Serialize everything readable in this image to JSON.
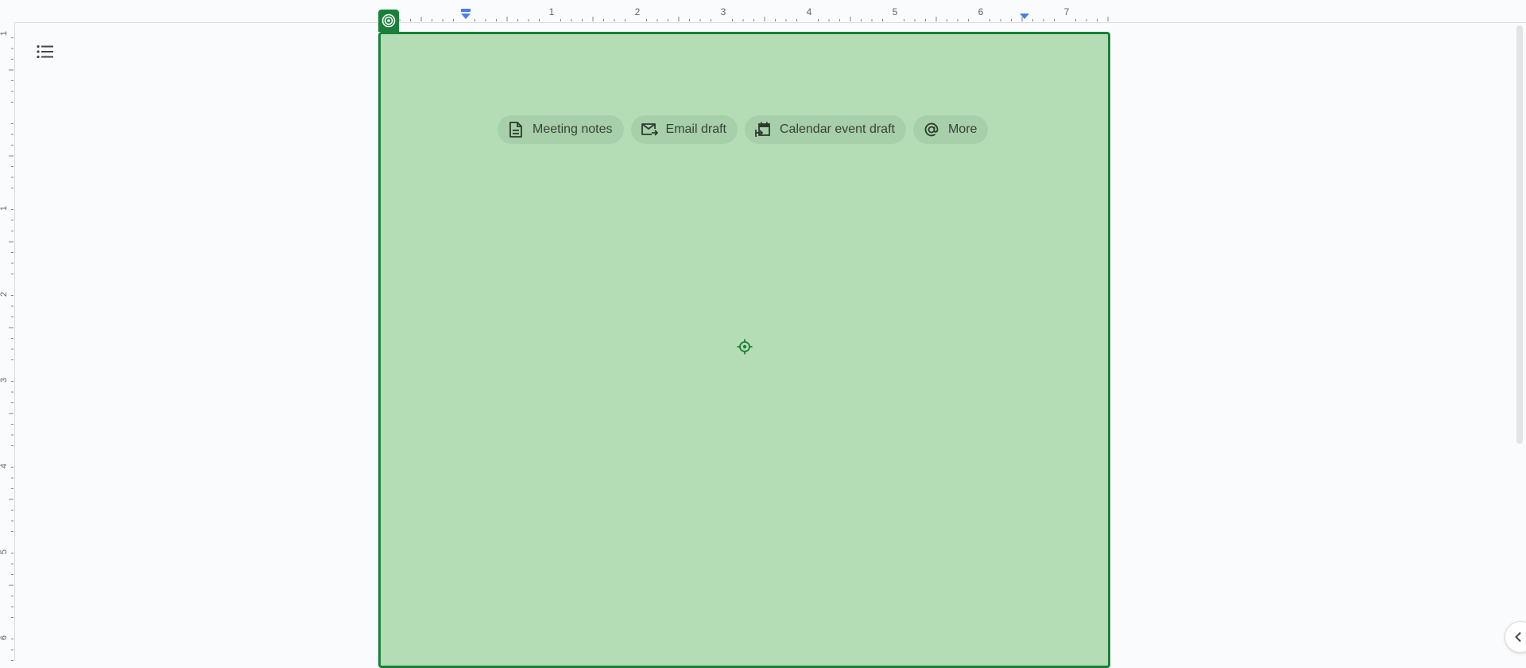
{
  "ruler": {
    "horizontal_labels": [
      "1",
      "2",
      "3",
      "4",
      "5",
      "6",
      "7"
    ],
    "vertical_labels": [
      "1",
      "1",
      "2",
      "3",
      "4",
      "5",
      "6"
    ]
  },
  "toolbar": {
    "outline_icon": "list-icon"
  },
  "placeholder": {
    "badge_icon": "target-icon",
    "center_icon": "crosshair-icon",
    "chips": [
      {
        "label": "Meeting notes",
        "icon": "document-icon"
      },
      {
        "label": "Email draft",
        "icon": "mail-send-icon"
      },
      {
        "label": "Calendar event draft",
        "icon": "calendar-arrow-icon"
      },
      {
        "label": "More",
        "icon": "at-sign-icon"
      }
    ]
  },
  "colors": {
    "page_fill": "#b4ddb6",
    "page_border": "#188038",
    "chip_fill": "#a7cfa9",
    "ruler_marker": "#4a7ee8"
  },
  "side_panel": {
    "collapse_icon": "chevron-left-icon"
  }
}
